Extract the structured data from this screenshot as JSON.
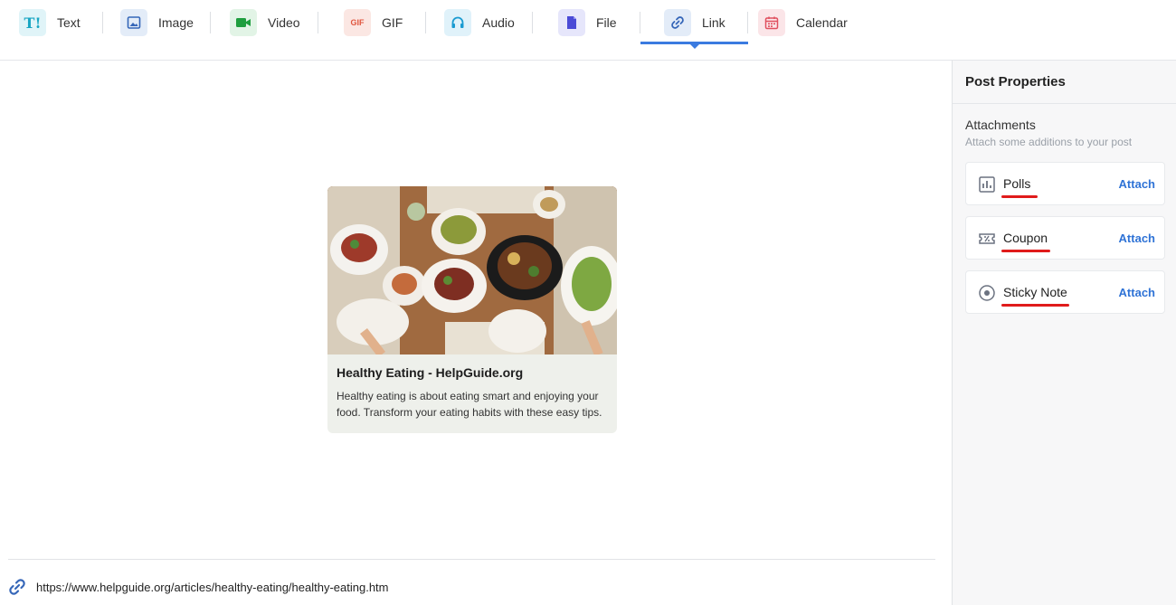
{
  "tabs": [
    {
      "label": "Text",
      "icon": "text-icon"
    },
    {
      "label": "Image",
      "icon": "image-icon"
    },
    {
      "label": "Video",
      "icon": "video-icon"
    },
    {
      "label": "GIF",
      "icon": "gif-icon",
      "icon_text": "GIF"
    },
    {
      "label": "Audio",
      "icon": "headphones-icon"
    },
    {
      "label": "File",
      "icon": "file-icon"
    },
    {
      "label": "Link",
      "icon": "link-icon"
    },
    {
      "label": "Calendar",
      "icon": "calendar-icon"
    }
  ],
  "active_tab": "Link",
  "text_icon_glyph": "T!",
  "colors": {
    "accent": "#3b7be0",
    "attach": "#2f73d6",
    "underline": "#e01b1b"
  },
  "preview": {
    "title": "Healthy Eating - HelpGuide.org",
    "description": "Healthy eating is about eating smart and enjoying your food. Transform your eating habits with these easy tips.",
    "image": "food-table-photo"
  },
  "url": "https://www.helpguide.org/articles/healthy-eating/healthy-eating.htm",
  "sidebar": {
    "title": "Post Properties",
    "section_title": "Attachments",
    "section_subtitle": "Attach some additions to your post",
    "items": [
      {
        "label": "Polls",
        "icon": "poll-chart-icon",
        "action": "Attach"
      },
      {
        "label": "Coupon",
        "icon": "coupon-icon",
        "action": "Attach"
      },
      {
        "label": "Sticky Note",
        "icon": "sticky-note-icon",
        "action": "Attach"
      }
    ]
  }
}
